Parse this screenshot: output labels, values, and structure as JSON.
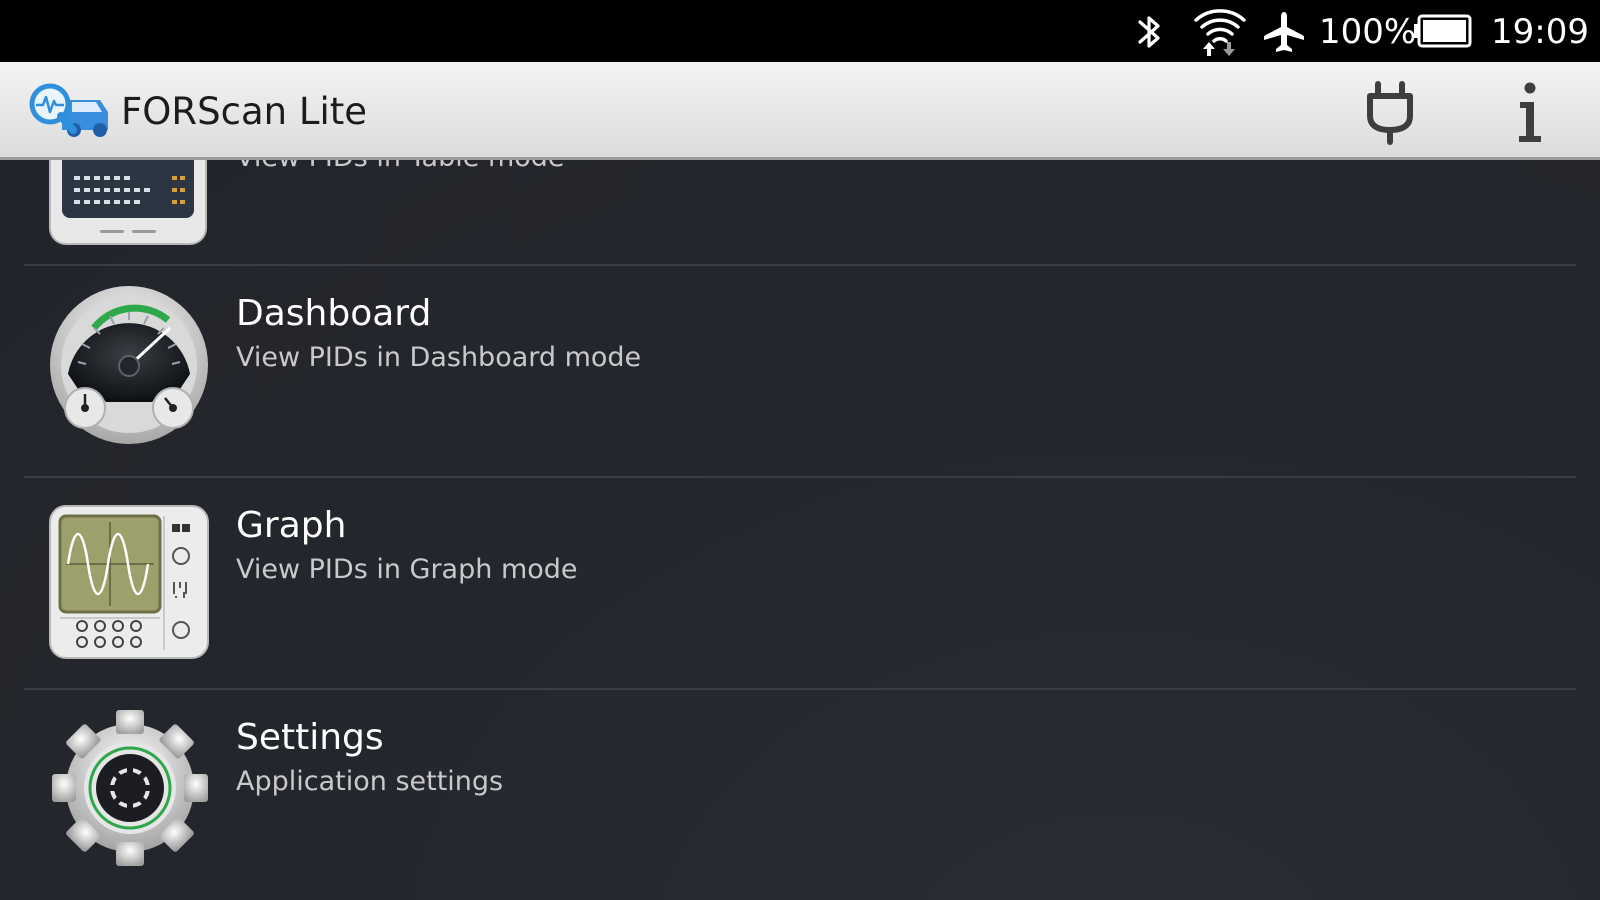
{
  "status_bar": {
    "battery_text": "100%",
    "time": "19:09",
    "icons": [
      "bluetooth-icon",
      "wifi-icon",
      "airplane-mode-icon",
      "battery-icon"
    ]
  },
  "app_bar": {
    "title": "FORScan Lite",
    "actions": [
      "connect-plug-icon",
      "info-icon"
    ]
  },
  "menu_items": [
    {
      "title": "",
      "subtitle": "View PIDs in Table mode",
      "icon": "table-monitor-icon"
    },
    {
      "title": "Dashboard",
      "subtitle": "View PIDs in Dashboard mode",
      "icon": "dashboard-gauge-icon"
    },
    {
      "title": "Graph",
      "subtitle": "View PIDs in Graph mode",
      "icon": "oscilloscope-graph-icon"
    },
    {
      "title": "Settings",
      "subtitle": "Application settings",
      "icon": "gear-icon"
    }
  ],
  "colors": {
    "status_bar_bg": "#000000",
    "app_bar_bg": "#e6e6e6",
    "list_bg": "#24262d",
    "divider": "#3b3d45",
    "accent_green": "#2ea84a",
    "logo_blue": "#2f8fdc"
  }
}
